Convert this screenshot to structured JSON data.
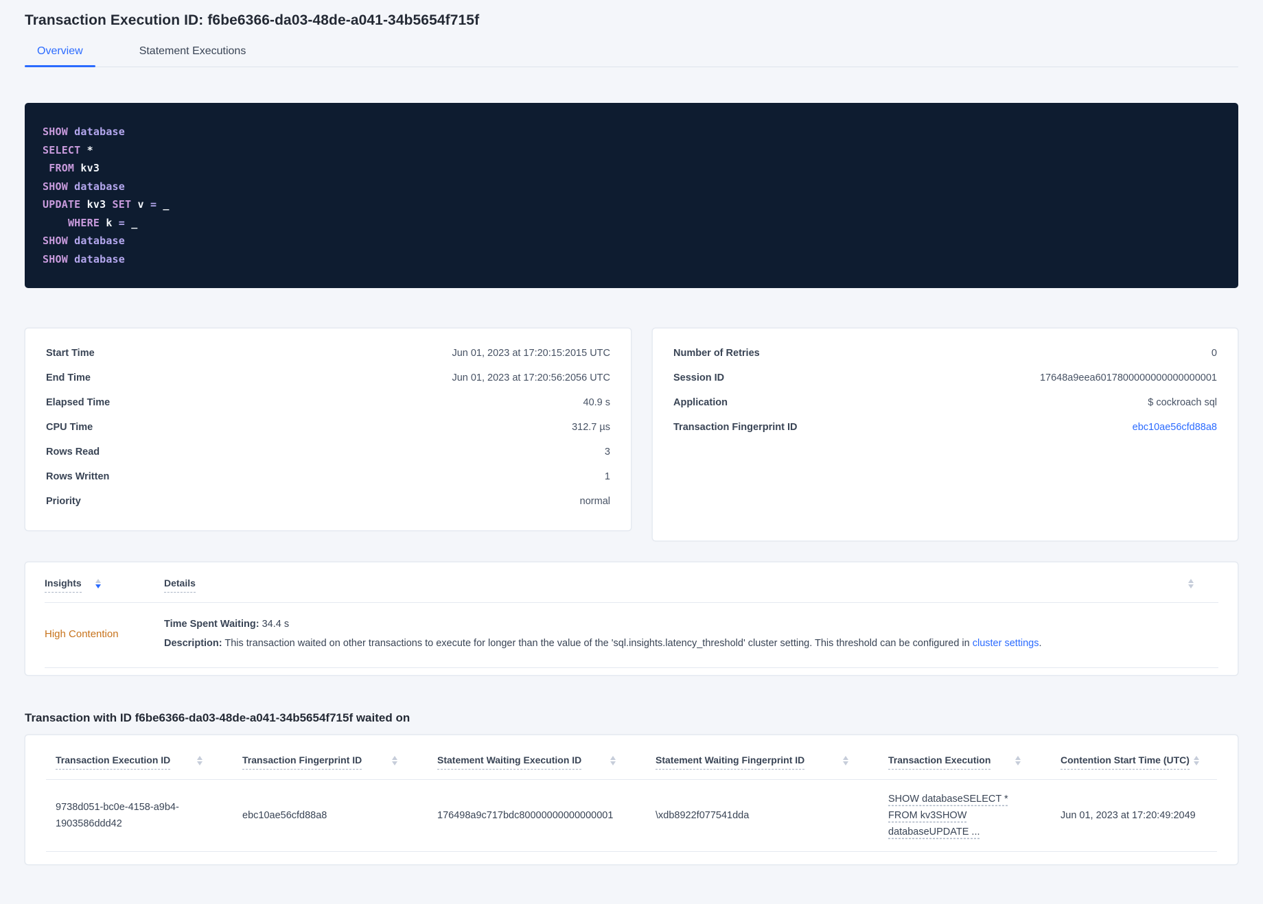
{
  "colors": {
    "accent_blue": "#2b6bff",
    "insight_orange": "#c7731c",
    "code_background": "#0e1c30",
    "code_keyword_purple": "#c99bdd",
    "code_keyword_violet": "#b4a7ee"
  },
  "header": {
    "title": "Transaction Execution ID: f6be6366-da03-48de-a041-34b5654f715f",
    "tabs": [
      {
        "label": "Overview",
        "active": true
      },
      {
        "label": "Statement Executions",
        "active": false
      }
    ]
  },
  "sql": {
    "lines": [
      [
        {
          "c": "kw",
          "t": "SHOW"
        },
        {
          "c": "pl",
          "t": " "
        },
        {
          "c": "kw2",
          "t": "database"
        }
      ],
      [
        {
          "c": "kw",
          "t": "SELECT"
        },
        {
          "c": "pl",
          "t": " *"
        }
      ],
      [
        {
          "c": "pl",
          "t": " "
        },
        {
          "c": "kw",
          "t": "FROM"
        },
        {
          "c": "pl",
          "t": " kv3"
        }
      ],
      [
        {
          "c": "kw",
          "t": "SHOW"
        },
        {
          "c": "pl",
          "t": " "
        },
        {
          "c": "kw2",
          "t": "database"
        }
      ],
      [
        {
          "c": "kw",
          "t": "UPDATE"
        },
        {
          "c": "pl",
          "t": " kv3 "
        },
        {
          "c": "kw",
          "t": "SET"
        },
        {
          "c": "pl",
          "t": " v "
        },
        {
          "c": "kw2",
          "t": "="
        },
        {
          "c": "pl",
          "t": " _"
        }
      ],
      [
        {
          "c": "pl",
          "t": "    "
        },
        {
          "c": "kw",
          "t": "WHERE"
        },
        {
          "c": "pl",
          "t": " k "
        },
        {
          "c": "kw2",
          "t": "="
        },
        {
          "c": "pl",
          "t": " _"
        }
      ],
      [
        {
          "c": "kw",
          "t": "SHOW"
        },
        {
          "c": "pl",
          "t": " "
        },
        {
          "c": "kw2",
          "t": "database"
        }
      ],
      [
        {
          "c": "kw",
          "t": "SHOW"
        },
        {
          "c": "pl",
          "t": " "
        },
        {
          "c": "kw2",
          "t": "database"
        }
      ]
    ]
  },
  "overview_left": {
    "rows": [
      {
        "label": "Start Time",
        "value": "Jun 01, 2023 at 17:20:15:2015 UTC"
      },
      {
        "label": "End Time",
        "value": "Jun 01, 2023 at 17:20:56:2056 UTC"
      },
      {
        "label": "Elapsed Time",
        "value": "40.9 s"
      },
      {
        "label": "CPU Time",
        "value": "312.7 µs"
      },
      {
        "label": "Rows Read",
        "value": "3"
      },
      {
        "label": "Rows Written",
        "value": "1"
      },
      {
        "label": "Priority",
        "value": "normal"
      }
    ]
  },
  "overview_right": {
    "rows": [
      {
        "label": "Number of Retries",
        "value": "0"
      },
      {
        "label": "Session ID",
        "value": "17648a9eea6017800000000000000001"
      },
      {
        "label": "Application",
        "value": "$ cockroach sql"
      },
      {
        "label": "Transaction Fingerprint ID",
        "value": "ebc10ae56cfd88a8"
      }
    ]
  },
  "insights": {
    "columns": [
      "Insights",
      "Details"
    ],
    "row": {
      "insight": "High Contention",
      "waiting_label": "Time Spent Waiting:",
      "waiting_value": " 34.4 s",
      "description_label": "Description:",
      "description_text": " This transaction waited on other transactions to execute for longer than the value of the 'sql.insights.latency_threshold' cluster setting. This threshold can be configured in ",
      "description_link": "cluster settings",
      "description_suffix": "."
    }
  },
  "waited_on": {
    "heading": "Transaction with ID f6be6366-da03-48de-a041-34b5654f715f waited on",
    "columns": [
      "Transaction Execution ID",
      "Transaction Fingerprint ID",
      "Statement Waiting Execution ID",
      "Statement Waiting Fingerprint ID",
      "Transaction Execution",
      "Contention Start Time (UTC)"
    ],
    "row": {
      "transaction_execution_id": "9738d051-bc0e-4158-a9b4-1903586ddd42",
      "transaction_fingerprint_id": "ebc10ae56cfd88a8",
      "statement_waiting_execution_id": "176498a9c717bdc80000000000000001",
      "statement_waiting_fingerprint_id": "\\xdb8922f077541dda",
      "transaction_execution": "SHOW databaseSELECT * FROM kv3SHOW databaseUPDATE ...",
      "contention_start_time": "Jun 01, 2023 at 17:20:49:2049"
    }
  }
}
